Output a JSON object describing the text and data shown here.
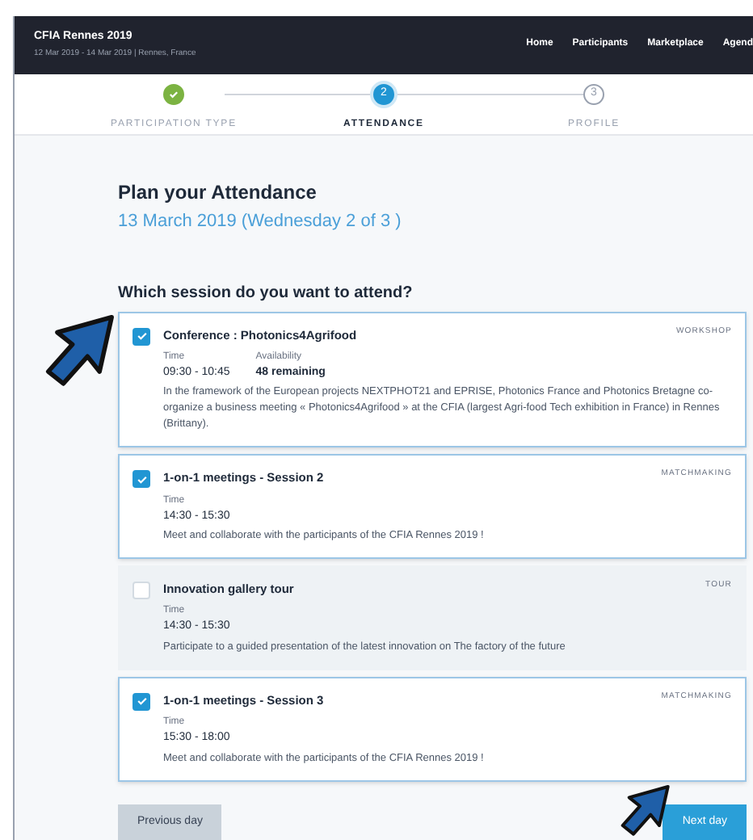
{
  "header": {
    "event_title": "CFIA Rennes 2019",
    "event_subtitle": "12 Mar 2019 - 14 Mar 2019 | Rennes, France",
    "nav": [
      "Home",
      "Participants",
      "Marketplace",
      "Agend"
    ]
  },
  "stepper": [
    {
      "label": "PARTICIPATION TYPE",
      "completed": true,
      "selected": false
    },
    {
      "label": "ATTENDANCE",
      "number": "2",
      "completed": false,
      "selected": true
    },
    {
      "label": "PROFILE",
      "number": "3",
      "completed": false,
      "selected": false
    }
  ],
  "title": "Plan your Attendance",
  "date": "13 March 2019 (Wednesday 2 of 3 )",
  "question": "Which session do you want to attend?",
  "sessions": [
    {
      "name": "Conference : Photonics4Agrifood",
      "type": "WORKSHOP",
      "checked": true,
      "time_label": "Time",
      "time": "09:30 - 10:45",
      "availability_label": "Availability",
      "availability": "48 remaining",
      "description": "In the framework of the European projects NEXTPHOT21 and EPRISE, Photonics France and Photonics Bretagne co-organize a business meeting « Photonics4Agrifood » at the CFIA (largest Agri-food Tech exhibition in France) in Rennes (Brittany)."
    },
    {
      "name": "1-on-1 meetings - Session 2",
      "type": "MATCHMAKING",
      "checked": true,
      "time_label": "Time",
      "time": "14:30 - 15:30",
      "description": "Meet and collaborate with the participants of the CFIA Rennes 2019 !"
    },
    {
      "name": "Innovation gallery tour",
      "type": "TOUR",
      "checked": false,
      "time_label": "Time",
      "time": "14:30 - 15:30",
      "description": "Participate to a guided presentation of the latest innovation on The factory of the future"
    },
    {
      "name": "1-on-1 meetings - Session 3",
      "type": "MATCHMAKING",
      "checked": true,
      "time_label": "Time",
      "time": "15:30 - 18:00",
      "description": "Meet and collaborate with the participants of the CFIA Rennes 2019 !"
    }
  ],
  "buttons": {
    "previous": "Previous day",
    "next": "Next day"
  }
}
